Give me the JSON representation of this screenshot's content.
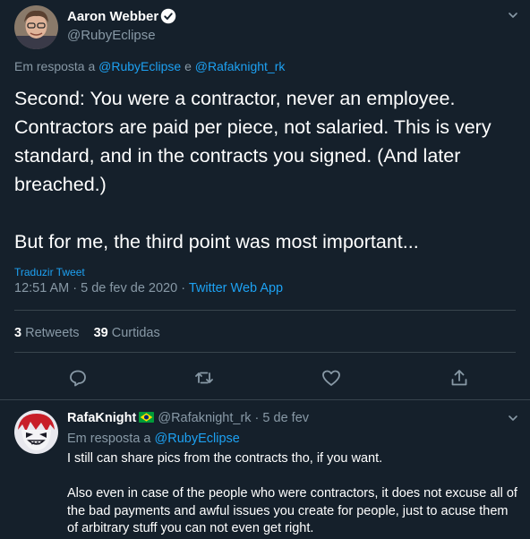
{
  "main_tweet": {
    "author_name": "Aaron Webber",
    "author_handle": "@RubyEclipse",
    "replying_prefix": "Em resposta a ",
    "replying_to_1": "@RubyEclipse",
    "replying_joiner": " e ",
    "replying_to_2": "@Rafaknight_rk",
    "body_p1": "Second: You were a contractor, never an employee. Contractors are paid per piece, not salaried. This is very standard, and in the contracts you signed. (And later breached.)",
    "body_p2": "But for me, the third point was most important...",
    "translate_label": "Traduzir Tweet",
    "timestamp": "12:51 AM · 5 de fev de 2020 · ",
    "source": "Twitter Web App",
    "retweets_count": "3",
    "retweets_label": " Retweets",
    "likes_count": "39",
    "likes_label": " Curtidas",
    "actions": [
      "reply-icon",
      "retweet-icon",
      "like-icon",
      "share-icon"
    ]
  },
  "reply": {
    "author_name": "RafaKnight",
    "author_handle": "@Rafaknight_rk",
    "separator": " · ",
    "date": "5 de fev",
    "flag_icon": "brazil-flag-icon",
    "replying_prefix": "Em resposta a ",
    "replying_to": "@RubyEclipse",
    "body_p1": "I still can share pics from the contracts tho, if you want.",
    "body_p2": "Also even in case of the people who were contractors, it does not excuse all of the bad payments and awful issues you create for people, just to acuse them of arbitrary stuff you can not even get right."
  },
  "colors": {
    "background": "#15202b",
    "border": "#38444d",
    "text_secondary": "#8899a6",
    "accent": "#1da1f2"
  }
}
